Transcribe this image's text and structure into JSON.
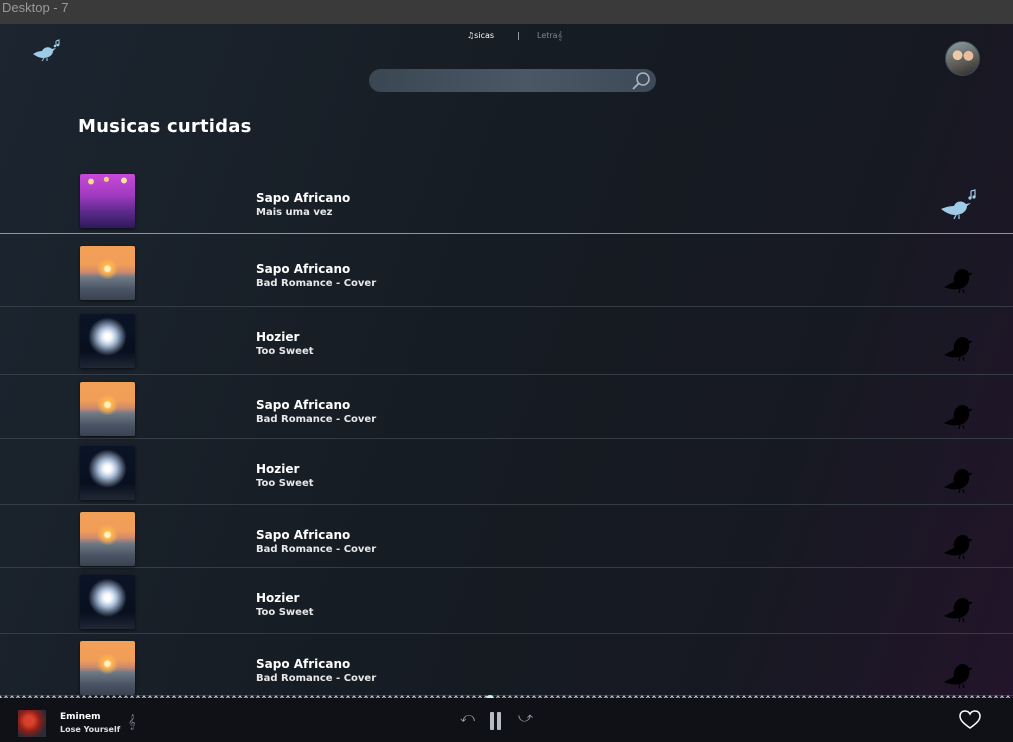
{
  "window": {
    "title": "Desktop - 7"
  },
  "header": {
    "logo_icon": "bird-logo-icon",
    "tabs": [
      {
        "label": "♫sicas",
        "active": true
      },
      {
        "label": "|",
        "active": false
      },
      {
        "label": "Letra𝄞",
        "active": false
      }
    ],
    "search": {
      "placeholder": "",
      "icon": "search-icon"
    },
    "avatar_icon": "user-avatar"
  },
  "main": {
    "title": "Musicas curtidas",
    "tracks": [
      {
        "artist": "Sapo Africano",
        "song": "Mais uma vez",
        "image": "concert",
        "favorited": true
      },
      {
        "artist": "Sapo Africano",
        "song": "Bad Romance - Cover",
        "image": "sunset",
        "favorited": false
      },
      {
        "artist": "Hozier",
        "song": "Too Sweet",
        "image": "firework",
        "favorited": false
      },
      {
        "artist": "Sapo Africano",
        "song": "Bad Romance - Cover",
        "image": "sunset",
        "favorited": false
      },
      {
        "artist": "Hozier",
        "song": "Too Sweet",
        "image": "firework",
        "favorited": false
      },
      {
        "artist": "Sapo Africano",
        "song": "Bad Romance - Cover",
        "image": "sunset",
        "favorited": false
      },
      {
        "artist": "Hozier",
        "song": "Too Sweet",
        "image": "firework",
        "favorited": false
      },
      {
        "artist": "Sapo Africano",
        "song": "Bad Romance - Cover",
        "image": "sunset",
        "favorited": false
      }
    ]
  },
  "player": {
    "artist": "Eminem",
    "song": "Lose Yourself",
    "clef_icon": "𝄞",
    "progress": 0.48,
    "prev_icon": "⤺",
    "next_icon": "⤻",
    "heart_icon": "heart-outline-icon"
  },
  "colors": {
    "bird_active": "#9fcbe6",
    "bird_inactive": "#000000",
    "progress_knob": "#c8f2e4"
  }
}
